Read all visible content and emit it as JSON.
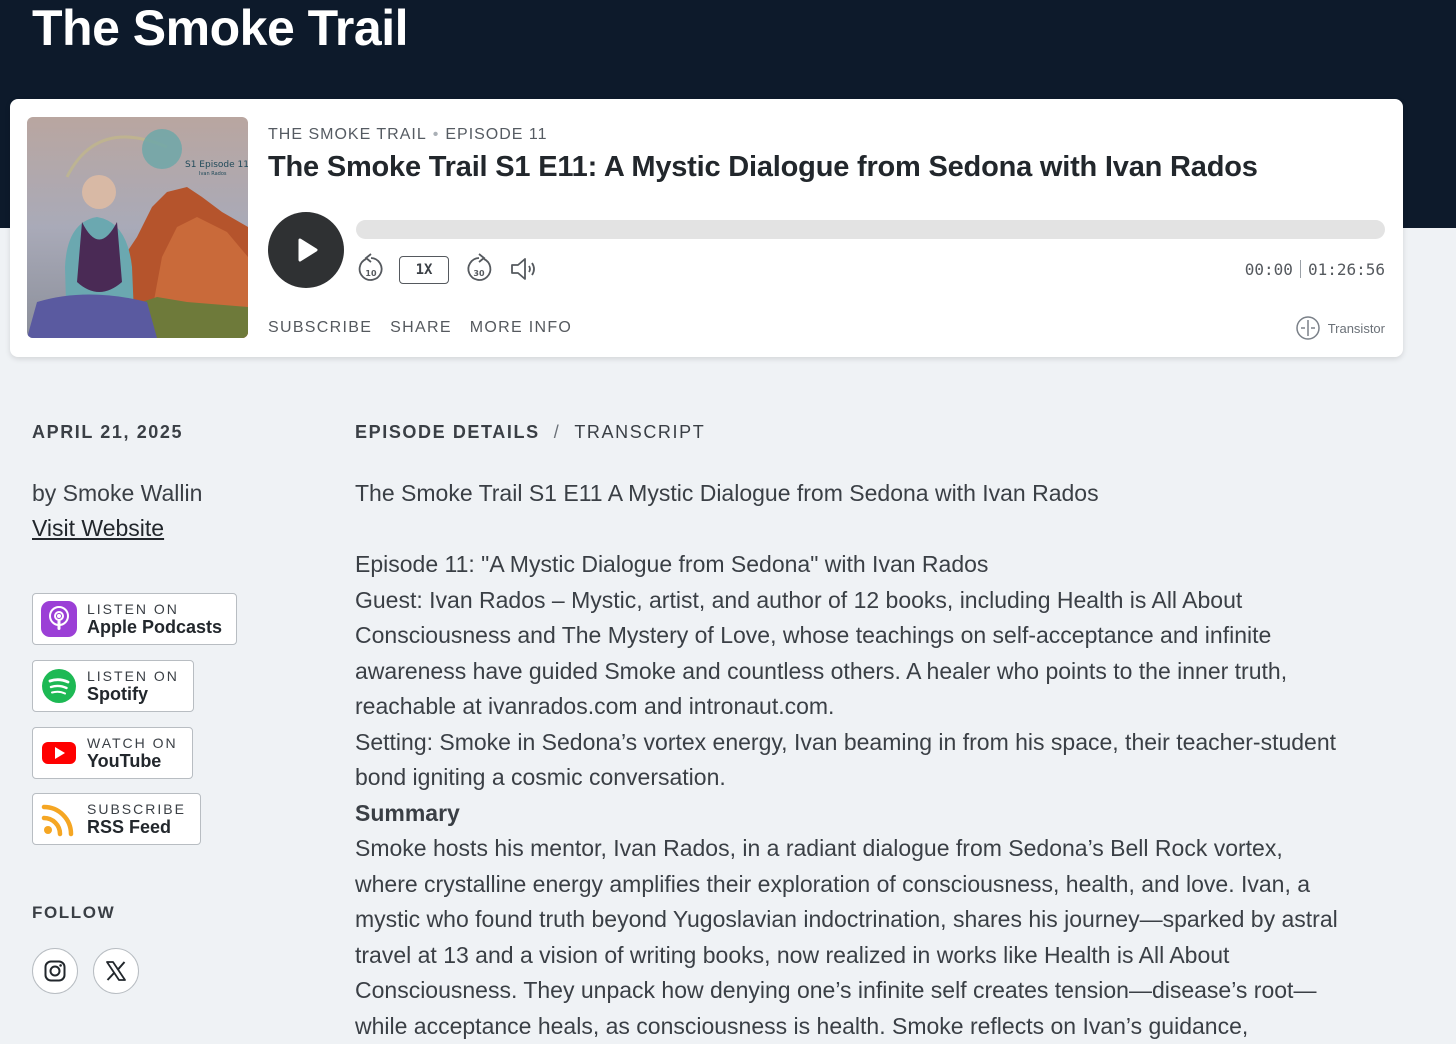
{
  "site": {
    "title": "The Smoke Trail"
  },
  "player": {
    "show_name": "THE SMOKE TRAIL",
    "episode_label": "EPISODE 11",
    "episode_title": "The Smoke Trail S1 E11: A Mystic Dialogue from Sedona with Ivan Rados",
    "cover_text": "S1 Episode 11",
    "cover_subtext": "Ivan Rados",
    "progress": 0,
    "rewind_label": "10",
    "forward_label": "30",
    "speed": "1X",
    "current_time": "00:00",
    "duration": "01:26:56",
    "links": {
      "subscribe": "SUBSCRIBE",
      "share": "SHARE",
      "more_info": "MORE INFO"
    },
    "brand": "Transistor",
    "icons": {
      "play": "play-icon",
      "rewind": "rewind-10-icon",
      "forward": "forward-30-icon",
      "volume": "volume-icon",
      "brand": "transistor-logo-icon"
    }
  },
  "sidebar": {
    "date": "APRIL 21, 2025",
    "byline": "by Smoke Wallin",
    "visit_website": "Visit Website",
    "listen": [
      {
        "top": "LISTEN ON",
        "main": "Apple Podcasts",
        "icon": "apple-podcasts-icon",
        "color": "#9b3fd6"
      },
      {
        "top": "LISTEN ON",
        "main": "Spotify",
        "icon": "spotify-icon",
        "color": "#1db954"
      },
      {
        "top": "WATCH ON",
        "main": "YouTube",
        "icon": "youtube-icon",
        "color": "#ff0000"
      },
      {
        "top": "SUBSCRIBE",
        "main": "RSS Feed",
        "icon": "rss-icon",
        "color": "#f5a623"
      }
    ],
    "follow_label": "FOLLOW",
    "social": [
      {
        "icon": "instagram-icon"
      },
      {
        "icon": "x-twitter-icon"
      }
    ]
  },
  "main": {
    "tabs": {
      "details": "EPISODE DETAILS",
      "separator": "/",
      "transcript": "TRANSCRIPT"
    },
    "intro": "The Smoke Trail S1 E11 A Mystic Dialogue from Sedona with Ivan Rados",
    "episode_line": "Episode 11: \"A Mystic Dialogue from Sedona\" with Ivan Rados",
    "guest": "Guest: Ivan Rados – Mystic, artist, and author of 12 books, including Health is All About Consciousness and The Mystery of Love, whose teachings on self-acceptance and infinite awareness have guided Smoke and countless others. A healer who points to the inner truth, reachable at ivanrados.com and intronaut.com.",
    "setting": "Setting: Smoke in Sedona’s vortex energy, Ivan beaming in from his space, their teacher-student bond igniting a cosmic conversation.",
    "summary_heading": "Summary",
    "summary": "Smoke hosts his mentor, Ivan Rados, in a radiant dialogue from Sedona’s Bell Rock vortex, where crystalline energy amplifies their exploration of consciousness, health, and love. Ivan, a mystic who found truth beyond Yugoslavian indoctrination, shares his journey—sparked by astral travel at 13 and a vision of writing books, now realized in works like Health is All About Consciousness. They unpack how denying one’s infinite self creates tension—disease’s root—while acceptance heals, as consciousness is health. Smoke reflects on Ivan’s guidance,"
  }
}
